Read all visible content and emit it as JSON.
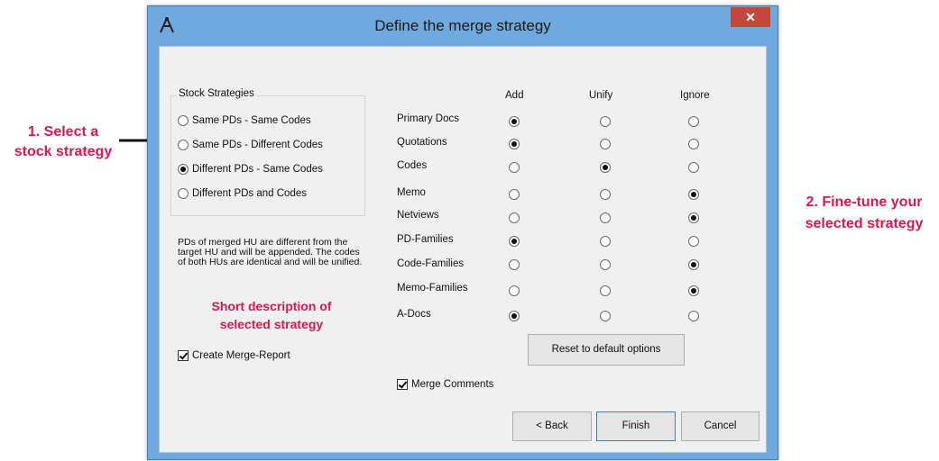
{
  "window": {
    "title": "Define the merge strategy",
    "close": "✕",
    "icon": "atlas-ti-app-icon"
  },
  "stock": {
    "title": "Stock Strategies",
    "options": [
      "Same PDs - Same Codes",
      "Same PDs - Different Codes",
      "Different PDs - Same Codes",
      "Different PDs and Codes"
    ],
    "selected_index": 2
  },
  "description": "PDs of merged HU are different from the target HU and will be appended. The codes of both HUs are identical and will be unified.",
  "create_report": {
    "label": "Create Merge-Report",
    "checked": true
  },
  "grid": {
    "columns": [
      "Add",
      "Unify",
      "Ignore"
    ],
    "rows": [
      {
        "label": "Primary Docs",
        "selected": "Add"
      },
      {
        "label": "Quotations",
        "selected": "Add"
      },
      {
        "label": "Codes",
        "selected": "Unify"
      },
      {
        "label": "Memo",
        "selected": "Ignore"
      },
      {
        "label": "Netviews",
        "selected": "Ignore"
      },
      {
        "label": "PD-Families",
        "selected": "Add"
      },
      {
        "label": "Code-Families",
        "selected": "Ignore"
      },
      {
        "label": "Memo-Families",
        "selected": "Ignore"
      },
      {
        "label": "A-Docs",
        "selected": "Add"
      }
    ]
  },
  "reset_label": "Reset to default options",
  "merge_comments": {
    "label": "Merge Comments",
    "checked": true
  },
  "buttons": {
    "back": "< Back",
    "finish": "Finish",
    "cancel": "Cancel"
  },
  "annotations": {
    "step1": [
      "1. Select a",
      "stock strategy"
    ],
    "step2": [
      "2. Fine-tune your",
      "selected strategy"
    ],
    "short_desc": [
      "Short description of",
      "selected strategy"
    ],
    "color": "#e0174e"
  }
}
